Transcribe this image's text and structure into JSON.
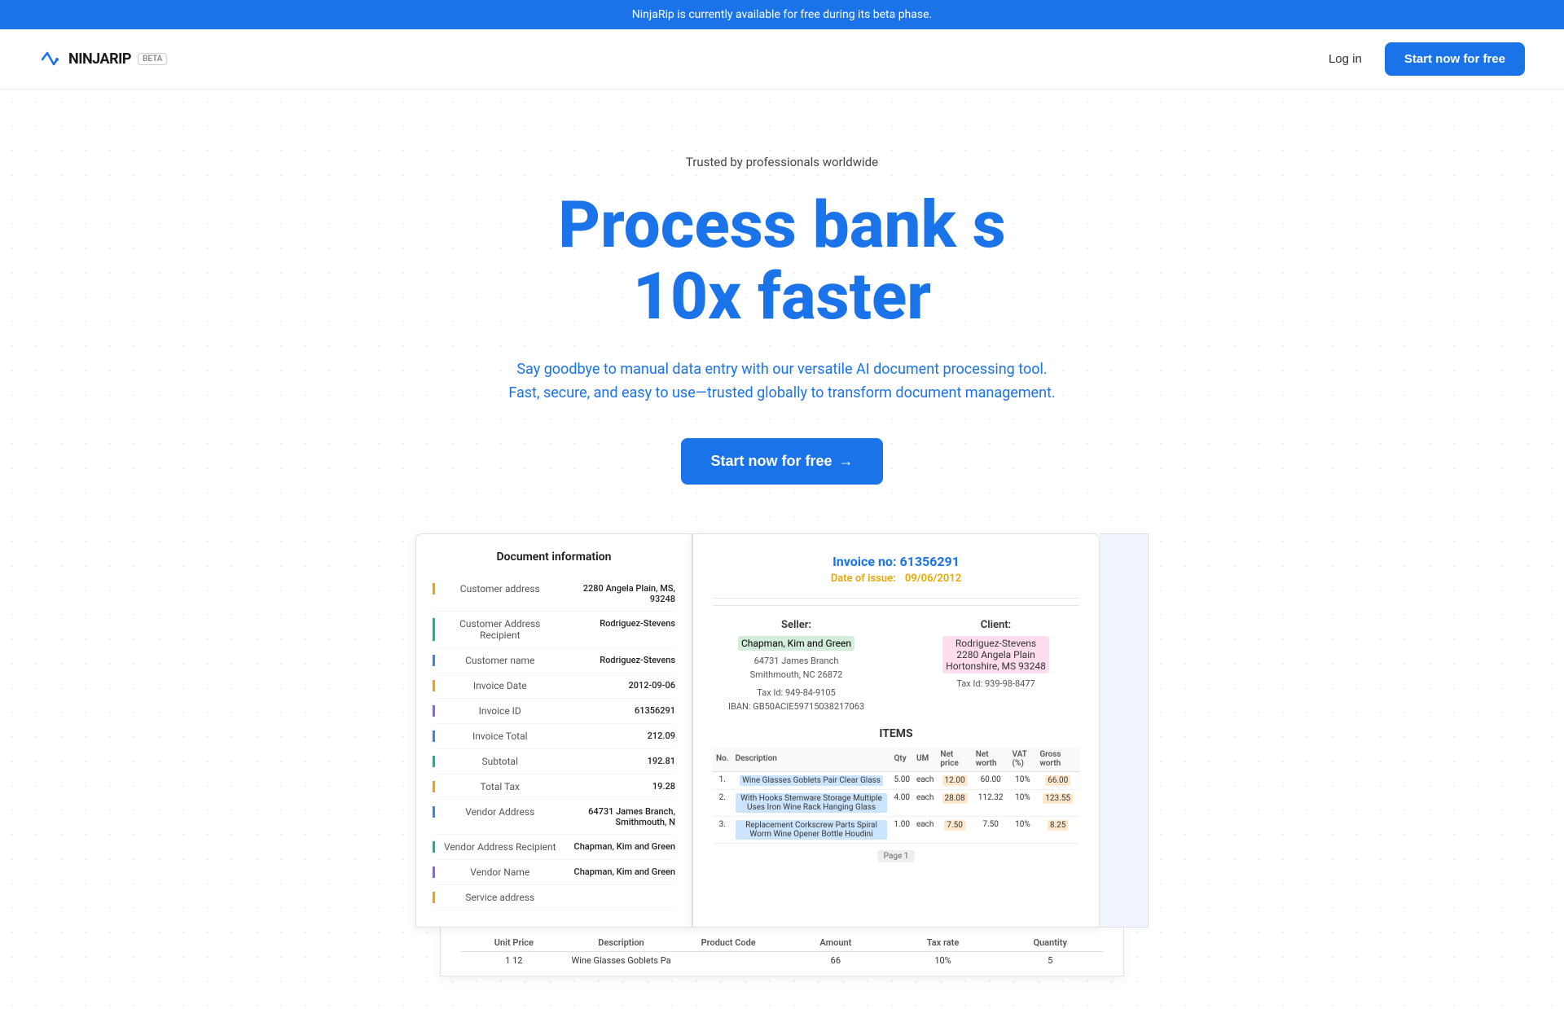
{
  "banner": {
    "text": "NinjaRip is currently available for free during its beta phase."
  },
  "nav": {
    "logo_text": "NINJARIP",
    "beta_label": "BETA",
    "login_label": "Log in",
    "start_btn_label": "Start now for free"
  },
  "hero": {
    "trusted_label": "Trusted by professionals worldwide",
    "title_line1": "Process bank s",
    "title_line2": "10x faster",
    "subtitle_line1": "Say goodbye to manual data entry with our versatile AI document processing tool.",
    "subtitle_line2": "Fast, secure, and easy to use—trusted globally to transform document management.",
    "cta_label": "Start now for free",
    "cta_arrow": "→"
  },
  "doc_preview": {
    "left": {
      "section_title": "Document information",
      "rows": [
        {
          "label": "Customer address",
          "value": "2280 Angela Plain, MS, 93248",
          "color": "#f59e0b"
        },
        {
          "label": "Customer Address Recipient",
          "value": "Rodriguez-Stevens",
          "color": "#10b981"
        },
        {
          "label": "Customer name",
          "value": "Rodriguez-Stevens",
          "color": "#3b82f6"
        },
        {
          "label": "Invoice Date",
          "value": "2012-09-06",
          "color": "#f59e0b"
        },
        {
          "label": "Invoice ID",
          "value": "61356291",
          "color": "#8b5cf6"
        },
        {
          "label": "Invoice Total",
          "value": "212.09",
          "color": "#3b82f6"
        },
        {
          "label": "Subtotal",
          "value": "192.81",
          "color": "#10b981"
        },
        {
          "label": "Total Tax",
          "value": "19.28",
          "color": "#f59e0b"
        },
        {
          "label": "Vendor Address",
          "value": "64731 James Branch, Smithmouth, N",
          "color": "#3b82f6"
        },
        {
          "label": "Vendor Address Recipient",
          "value": "Chapman, Kim and Green",
          "color": "#10b981"
        },
        {
          "label": "Vendor Name",
          "value": "Chapman, Kim and Green",
          "color": "#8b5cf6"
        },
        {
          "label": "Service address",
          "value": "",
          "color": "#f59e0b"
        }
      ]
    },
    "right": {
      "invoice_label": "Invoice no:",
      "invoice_number": "61356291",
      "date_label": "Date of issue:",
      "date_value": "09/06/2012",
      "seller_label": "Seller:",
      "seller_name": "Chapman, Kim and Green",
      "seller_address1": "64731 James Branch",
      "seller_city": "Smithmouth, NC 26872",
      "seller_tax": "Tax Id: 949-84-9105",
      "seller_iban": "IBAN: GB50ACIE59715038217063",
      "client_label": "Client:",
      "client_name": "Rodriguez-Stevens",
      "client_address1": "2280 Angela Plain",
      "client_city": "Hortonshire, MS 93248",
      "client_tax": "Tax Id: 939-98-8477",
      "items_label": "ITEMS",
      "items_headers": [
        "No.",
        "Description",
        "Qty",
        "UM",
        "Net price",
        "Net worth",
        "VAT (%)",
        "Gross worth"
      ],
      "items_rows": [
        {
          "no": "1.",
          "desc": "Wine Glasses Goblets Pair Clear Glass",
          "qty": "5.00",
          "um": "each",
          "net_price": "12.00",
          "net_worth": "60.00",
          "vat": "10%",
          "gross": "66.00"
        },
        {
          "no": "2.",
          "desc": "With Hooks Stemware Storage Multiple Uses Iron Wine Rack Hanging Glass",
          "qty": "4.00",
          "um": "each",
          "net_price": "28.08",
          "net_worth": "112.32",
          "vat": "10%",
          "gross": "123.55"
        },
        {
          "no": "3.",
          "desc": "Replacement Corkscrew Parts Spiral Worm Wine Opener Bottle Houdini",
          "qty": "1.00",
          "um": "each",
          "net_price": "7.50",
          "net_worth": "7.50",
          "vat": "10%",
          "gross": "8.25"
        }
      ],
      "page_label": "Page 1"
    },
    "bottom": {
      "headers": [
        "Unit Price",
        "Description",
        "Product Code",
        "Amount",
        "Tax rate",
        "Quantity"
      ],
      "row": [
        "12",
        "Wine Glasses Goblets Pa",
        "",
        "66",
        "10%",
        "5"
      ]
    }
  }
}
